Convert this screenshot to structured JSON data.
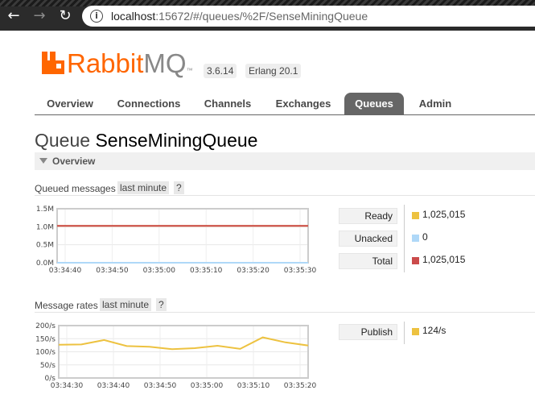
{
  "browser": {
    "url_host": "localhost",
    "url_path": ":15672/#/queues/%2F/SenseMiningQueue",
    "back_icon": "arrow-left-icon",
    "forward_icon": "arrow-right-icon",
    "reload_icon": "reload-icon",
    "info_icon": "info-icon"
  },
  "header": {
    "logo_text_1": "Rabbit",
    "logo_text_2": "MQ",
    "logo_tm": "™",
    "version": "3.6.14",
    "erlang": "Erlang 20.1"
  },
  "tabs": [
    {
      "label": "Overview",
      "active": false
    },
    {
      "label": "Connections",
      "active": false
    },
    {
      "label": "Channels",
      "active": false
    },
    {
      "label": "Exchanges",
      "active": false
    },
    {
      "label": "Queues",
      "active": true
    },
    {
      "label": "Admin",
      "active": false
    }
  ],
  "page": {
    "title_prefix": "Queue",
    "queue_name": "SenseMiningQueue",
    "section": "Overview"
  },
  "queued": {
    "label": "Queued messages",
    "range": "last minute",
    "help": "?",
    "stats": [
      {
        "label": "Ready",
        "value": "1,025,015",
        "color": "#edc240"
      },
      {
        "label": "Unacked",
        "value": "0",
        "color": "#afd8f8"
      },
      {
        "label": "Total",
        "value": "1,025,015",
        "color": "#cb4b4b"
      }
    ]
  },
  "rates": {
    "label": "Message rates",
    "range": "last minute",
    "help": "?",
    "stats": [
      {
        "label": "Publish",
        "value": "124/s",
        "color": "#edc240"
      }
    ]
  },
  "chart_data": [
    {
      "type": "line",
      "yticks": [
        "1.5M",
        "1.0M",
        "0.5M",
        "0.0M"
      ],
      "ylim": [
        0,
        1500000
      ],
      "x": [
        "03:34:40",
        "03:34:50",
        "03:35:00",
        "03:35:10",
        "03:35:20",
        "03:35:30"
      ],
      "series": [
        {
          "name": "Ready",
          "color": "#edc240",
          "values": [
            1025015,
            1025015,
            1025015,
            1025015,
            1025015,
            1025015,
            1025015
          ]
        },
        {
          "name": "Unacked",
          "color": "#afd8f8",
          "values": [
            0,
            0,
            0,
            0,
            0,
            0,
            0
          ]
        },
        {
          "name": "Total",
          "color": "#cb4b4b",
          "values": [
            1025015,
            1025015,
            1025015,
            1025015,
            1025015,
            1025015,
            1025015
          ]
        }
      ],
      "grid": true
    },
    {
      "type": "line",
      "yticks": [
        "200/s",
        "150/s",
        "100/s",
        "50/s",
        "0/s"
      ],
      "ylim": [
        0,
        200
      ],
      "x": [
        "03:34:30",
        "03:34:40",
        "03:34:50",
        "03:35:00",
        "03:35:10",
        "03:35:20"
      ],
      "series": [
        {
          "name": "Publish",
          "color": "#edc240",
          "values": [
            127,
            128,
            145,
            122,
            119,
            110,
            114,
            123,
            111,
            155,
            136,
            124
          ]
        }
      ],
      "grid": true
    }
  ]
}
